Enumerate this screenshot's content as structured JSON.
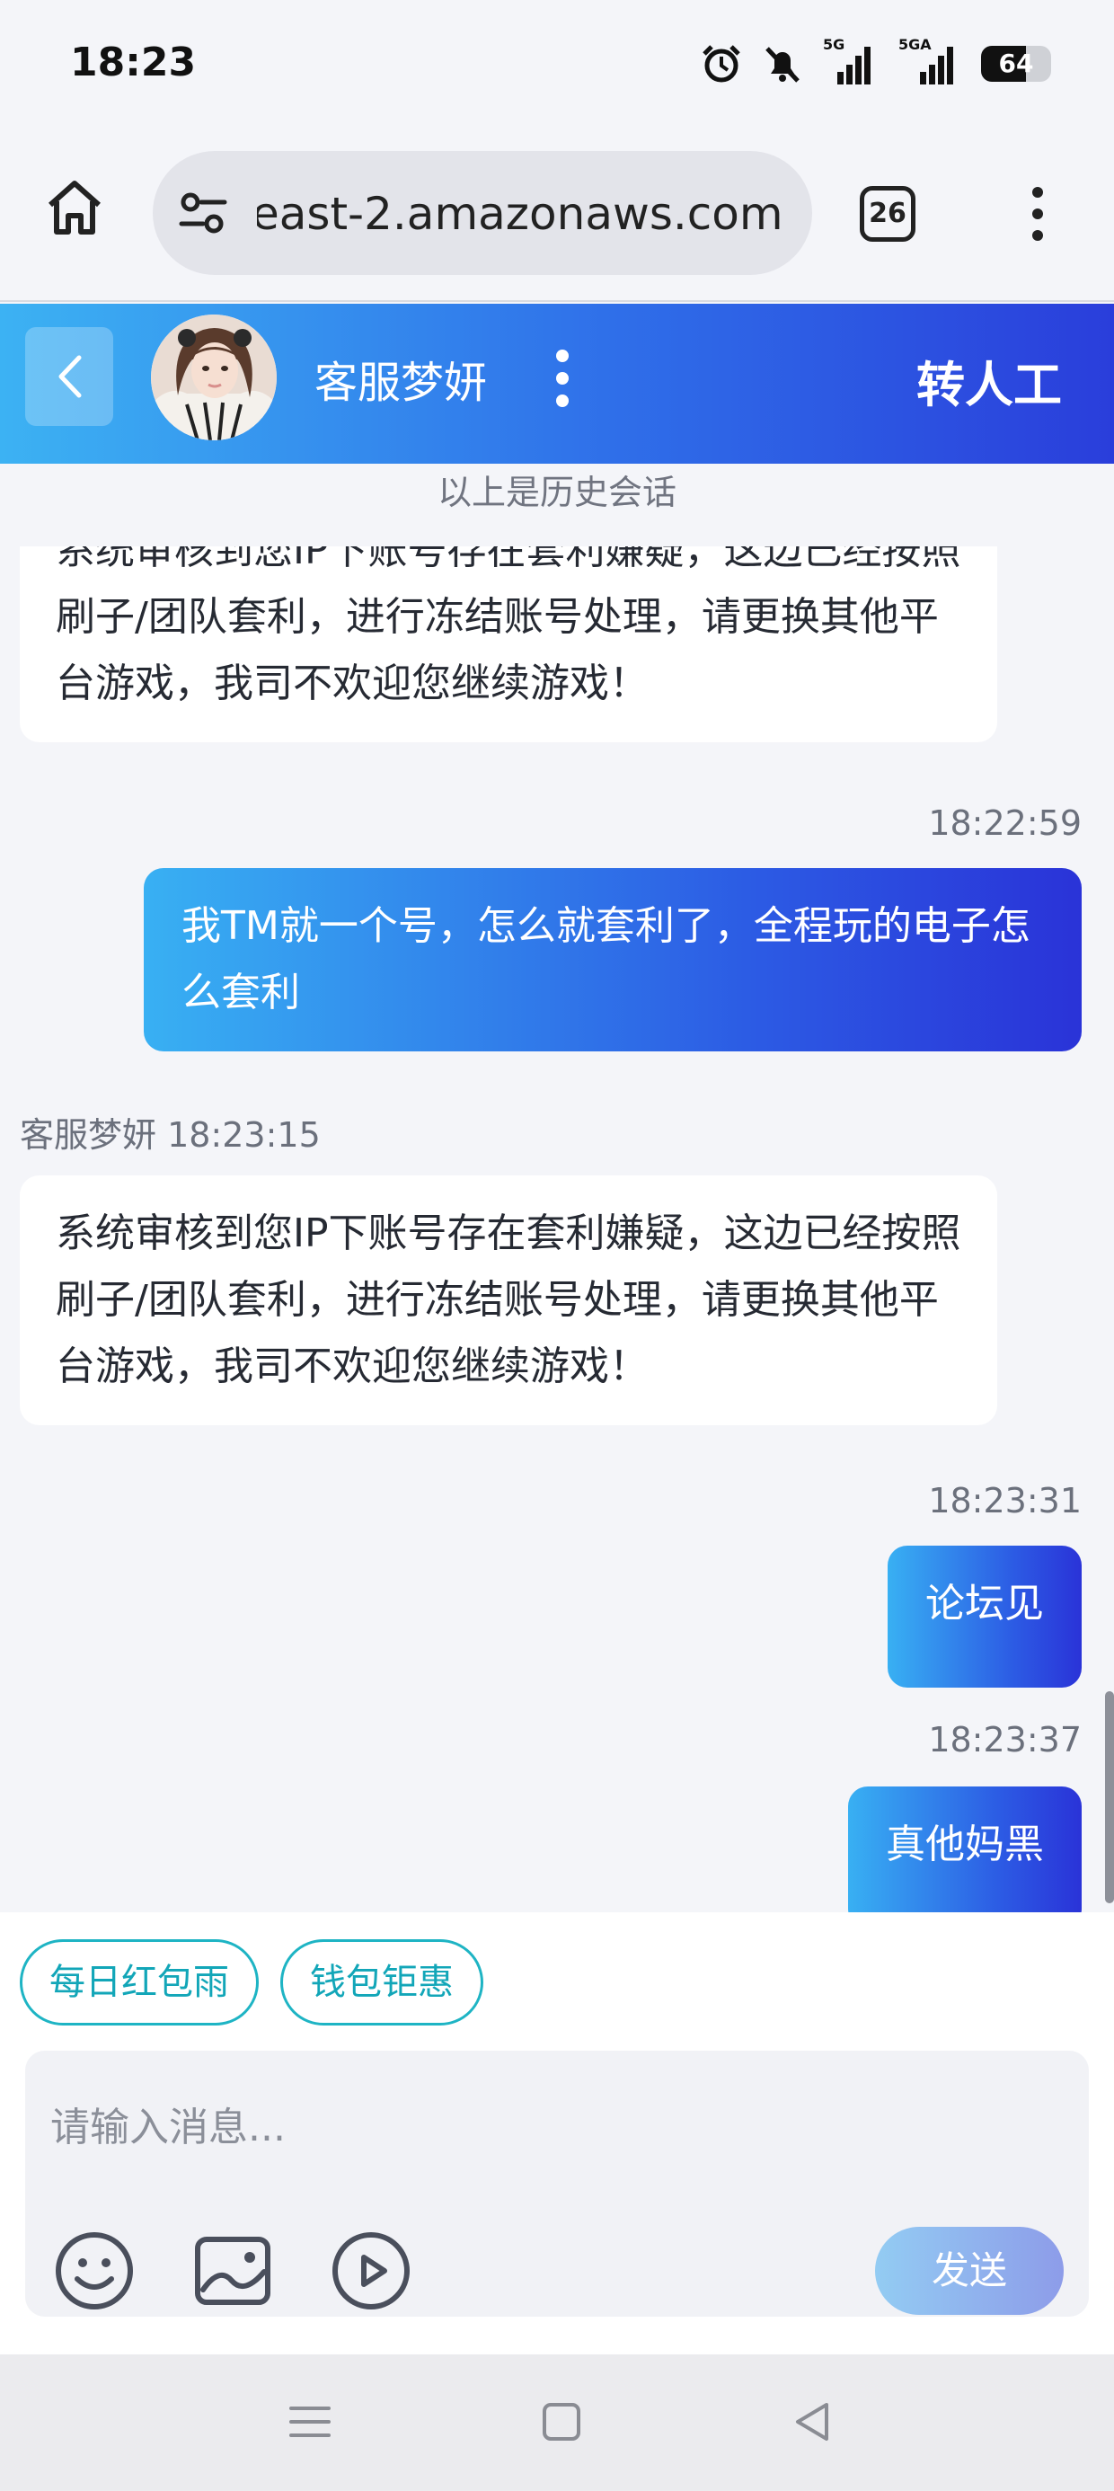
{
  "status_bar": {
    "time": "18:23",
    "signal_1": "5G",
    "signal_2": "5GA",
    "battery": "64",
    "battery_level": 0.64
  },
  "browser": {
    "url": "east-2.amazonaws.com",
    "tab_count": "26"
  },
  "chat_header": {
    "agent_name": "客服梦妍",
    "human_button": "转人工"
  },
  "history_note": "以上是历史会话",
  "messages": [
    {
      "side": "in",
      "text": "系统审核到您IP下账号存在套利嫌疑，这边已经按照刷子/团队套利，进行冻结账号处理，请更换其他平台游戏，我司不欢迎您继续游戏！"
    },
    {
      "side": "out",
      "time": "18:22:59",
      "text": "我TM就一个号，怎么就套利了，全程玩的电子怎么套利"
    },
    {
      "side": "in",
      "sender_time": "客服梦妍 18:23:15",
      "text": "系统审核到您IP下账号存在套利嫌疑，这边已经按照刷子/团队套利，进行冻结账号处理，请更换其他平台游戏，我司不欢迎您继续游戏！"
    },
    {
      "side": "out",
      "time": "18:23:31",
      "text": "论坛见"
    },
    {
      "side": "out",
      "time": "18:23:37",
      "text": "真他妈黑"
    }
  ],
  "quick_actions": [
    "每日红包雨",
    "钱包钜惠"
  ],
  "composer": {
    "placeholder": "请输入消息...",
    "send_label": "发送"
  },
  "colors": {
    "accent_gradient_start": "#3cb2f3",
    "accent_gradient_end": "#2a3edb",
    "chip": "#1eb4c4"
  }
}
